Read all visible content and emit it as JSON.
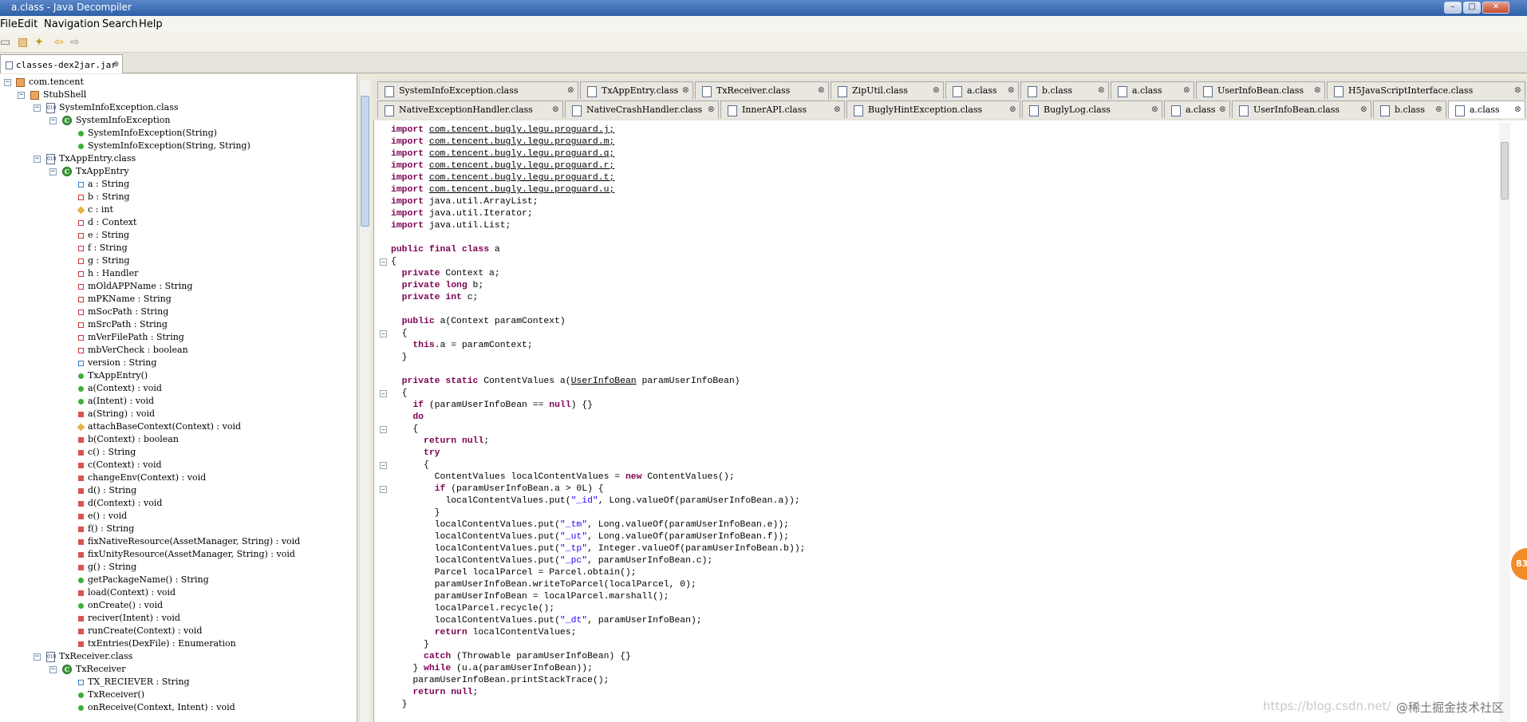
{
  "window": {
    "title": "a.class - Java Decompiler"
  },
  "menu": [
    "File",
    "Edit",
    "Navigation",
    "Search",
    "Help"
  ],
  "toolbar": {
    "icons": [
      "open-folder-icon",
      "wand-icon",
      "back-arrow-icon",
      "forward-arrow-icon"
    ]
  },
  "file_tab": {
    "label": "classes-dex2jar.jar"
  },
  "tree": [
    {
      "label": "com.tencent",
      "icon": "package"
    },
    {
      "label": "StubShell",
      "icon": "package"
    },
    {
      "label": "SystemInfoException.class",
      "icon": "file"
    },
    {
      "label": "SystemInfoException",
      "icon": "class"
    },
    {
      "label": "SystemInfoException(String)",
      "icon": "public-method"
    },
    {
      "label": "SystemInfoException(String, String)",
      "icon": "public-method"
    },
    {
      "label": "TxAppEntry.class",
      "icon": "file"
    },
    {
      "label": "TxAppEntry",
      "icon": "class"
    },
    {
      "label": "a : String",
      "icon": "default-field"
    },
    {
      "label": "b : String",
      "icon": "field"
    },
    {
      "label": "c : int",
      "icon": "protected-field"
    },
    {
      "label": "d : Context",
      "icon": "field"
    },
    {
      "label": "e : String",
      "icon": "field"
    },
    {
      "label": "f : String",
      "icon": "field"
    },
    {
      "label": "g : String",
      "icon": "field"
    },
    {
      "label": "h : Handler",
      "icon": "field"
    },
    {
      "label": "mOldAPPName : String",
      "icon": "field"
    },
    {
      "label": "mPKName : String",
      "icon": "field"
    },
    {
      "label": "mSocPath : String",
      "icon": "field"
    },
    {
      "label": "mSrcPath : String",
      "icon": "field"
    },
    {
      "label": "mVerFilePath : String",
      "icon": "field"
    },
    {
      "label": "mbVerCheck : boolean",
      "icon": "field"
    },
    {
      "label": "version : String",
      "icon": "default-field"
    },
    {
      "label": "TxAppEntry()",
      "icon": "public-method"
    },
    {
      "label": "a(Context) : void",
      "icon": "public-method"
    },
    {
      "label": "a(Intent) : void",
      "icon": "public-method"
    },
    {
      "label": "a(String) : void",
      "icon": "private-method"
    },
    {
      "label": "attachBaseContext(Context) : void",
      "icon": "protected-method"
    },
    {
      "label": "b(Context) : boolean",
      "icon": "private-method"
    },
    {
      "label": "c() : String",
      "icon": "private-method"
    },
    {
      "label": "c(Context) : void",
      "icon": "private-method"
    },
    {
      "label": "changeEnv(Context) : void",
      "icon": "private-method"
    },
    {
      "label": "d() : String",
      "icon": "private-method"
    },
    {
      "label": "d(Context) : void",
      "icon": "private-method"
    },
    {
      "label": "e() : void",
      "icon": "private-method"
    },
    {
      "label": "f() : String",
      "icon": "private-method"
    },
    {
      "label": "fixNativeResource(AssetManager, String) : void",
      "icon": "private-method"
    },
    {
      "label": "fixUnityResource(AssetManager, String) : void",
      "icon": "private-method"
    },
    {
      "label": "g() : String",
      "icon": "private-method"
    },
    {
      "label": "getPackageName() : String",
      "icon": "public-method"
    },
    {
      "label": "load(Context) : void",
      "icon": "private-method"
    },
    {
      "label": "onCreate() : void",
      "icon": "public-method"
    },
    {
      "label": "reciver(Intent) : void",
      "icon": "private-method"
    },
    {
      "label": "runCreate(Context) : void",
      "icon": "private-method"
    },
    {
      "label": "txEntries(DexFile) : Enumeration",
      "icon": "private-method"
    },
    {
      "label": "TxReceiver.class",
      "icon": "file"
    },
    {
      "label": "TxReceiver",
      "icon": "class"
    },
    {
      "label": "TX_RECIEVER : String",
      "icon": "default-field"
    },
    {
      "label": "TxReceiver()",
      "icon": "public-method"
    },
    {
      "label": "onReceive(Context, Intent) : void",
      "icon": "public-method"
    }
  ],
  "editor_tabs_row1": [
    "SystemInfoException.class",
    "TxAppEntry.class",
    "TxReceiver.class",
    "ZipUtil.class",
    "a.class",
    "b.class",
    "a.class",
    "UserInfoBean.class",
    "H5JavaScriptInterface.class"
  ],
  "editor_tabs_row2": [
    "NativeExceptionHandler.class",
    "NativeCrashHandler.class",
    "InnerAPI.class",
    "BuglyHintException.class",
    "BuglyLog.class",
    "a.class",
    "UserInfoBean.class",
    "b.class",
    "a.class"
  ],
  "code": [
    "import com.tencent.bugly.legu.proguard.j;",
    "import com.tencent.bugly.legu.proguard.m;",
    "import com.tencent.bugly.legu.proguard.q;",
    "import com.tencent.bugly.legu.proguard.r;",
    "import com.tencent.bugly.legu.proguard.t;",
    "import com.tencent.bugly.legu.proguard.u;",
    "import java.util.ArrayList;",
    "import java.util.Iterator;",
    "import java.util.List;",
    "",
    "public final class a",
    "{",
    "  private Context a;",
    "  private long b;",
    "  private int c;",
    "",
    "  public a(Context paramContext)",
    "  {",
    "    this.a = paramContext;",
    "  }",
    "",
    "  private static ContentValues a(UserInfoBean paramUserInfoBean)",
    "  {",
    "    if (paramUserInfoBean == null) {}",
    "    do",
    "    {",
    "      return null;",
    "      try",
    "      {",
    "        ContentValues localContentValues = new ContentValues();",
    "        if (paramUserInfoBean.a > 0L) {",
    "          localContentValues.put(\"_id\", Long.valueOf(paramUserInfoBean.a));",
    "        }",
    "        localContentValues.put(\"_tm\", Long.valueOf(paramUserInfoBean.e));",
    "        localContentValues.put(\"_ut\", Long.valueOf(paramUserInfoBean.f));",
    "        localContentValues.put(\"_tp\", Integer.valueOf(paramUserInfoBean.b));",
    "        localContentValues.put(\"_pc\", paramUserInfoBean.c);",
    "        Parcel localParcel = Parcel.obtain();",
    "        paramUserInfoBean.writeToParcel(localParcel, 0);",
    "        paramUserInfoBean = localParcel.marshall();",
    "        localParcel.recycle();",
    "        localContentValues.put(\"_dt\", paramUserInfoBean);",
    "        return localContentValues;",
    "      }",
    "      catch (Throwable paramUserInfoBean) {}",
    "    } while (u.a(paramUserInfoBean));",
    "    paramUserInfoBean.printStackTrace();",
    "    return null;",
    "  }"
  ],
  "badge": "83",
  "watermark": "https://blog.csdn.net/",
  "watermark2": "@稀土掘金技术社区"
}
